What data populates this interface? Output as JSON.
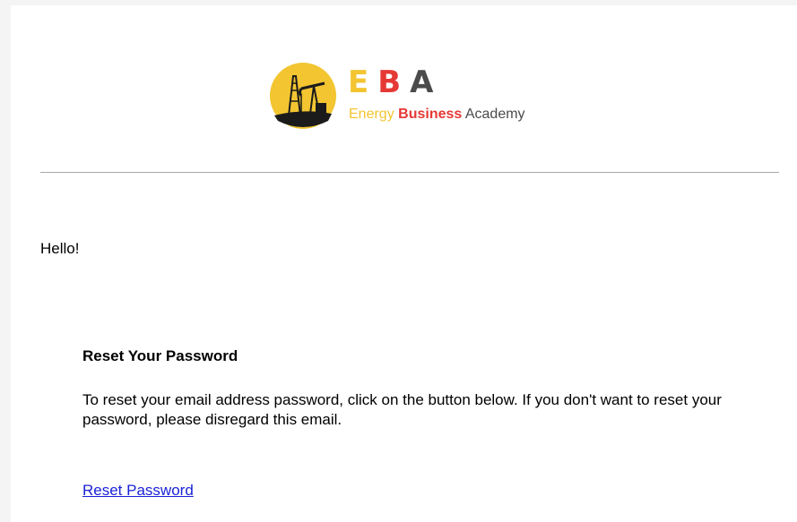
{
  "logo": {
    "letters": [
      "E",
      "B",
      "A"
    ],
    "tagline": [
      "Energy",
      "Business",
      "Academy"
    ]
  },
  "email": {
    "greeting": "Hello!",
    "heading": "Reset Your Password",
    "body": "To reset your email address password, click on the button below. If you don't want to reset your password, please disregard this email.",
    "link_label": "Reset Password"
  },
  "colors": {
    "yellow": "#f2c531",
    "red": "#e53935",
    "gray": "#4b4b4b",
    "link": "#1a22d6"
  },
  "icons": {
    "logo_mark": "oil-pumpjack-icon"
  }
}
